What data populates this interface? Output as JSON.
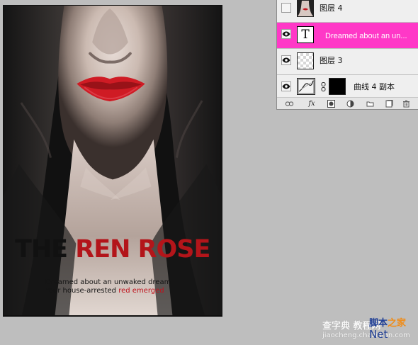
{
  "layers": [
    {
      "name": "图层 4",
      "visible": false,
      "type": "image",
      "selected": false
    },
    {
      "name": "Dreamed about an un...",
      "visible": true,
      "type": "text",
      "selected": true
    },
    {
      "name": "图层 3",
      "visible": true,
      "type": "transparent",
      "selected": false
    },
    {
      "name": "曲线 4 副本",
      "visible": true,
      "type": "curves",
      "selected": false
    }
  ],
  "layer_labels": {
    "text_thumb": "T"
  },
  "poster": {
    "title_black": "THE",
    "title_red": "REN ROSE",
    "line1": "Dreamed about an unwaked dream",
    "line2_prefix": "Your house-arrested ",
    "line2_red": "red emerged"
  },
  "toolbar": {
    "fx_label": "fx"
  },
  "watermark": {
    "site_cn": "查字典",
    "site_cn_2": "教程网",
    "url": "jiaocheng.chazidian.com",
    "right_top_blue": "脚本",
    "right_top_orange": "之家",
    "right_bottom": "Net"
  },
  "colors": {
    "workspace": "#bebebe",
    "selected_layer": "#ff38c7",
    "poster_red": "#b3151a"
  }
}
